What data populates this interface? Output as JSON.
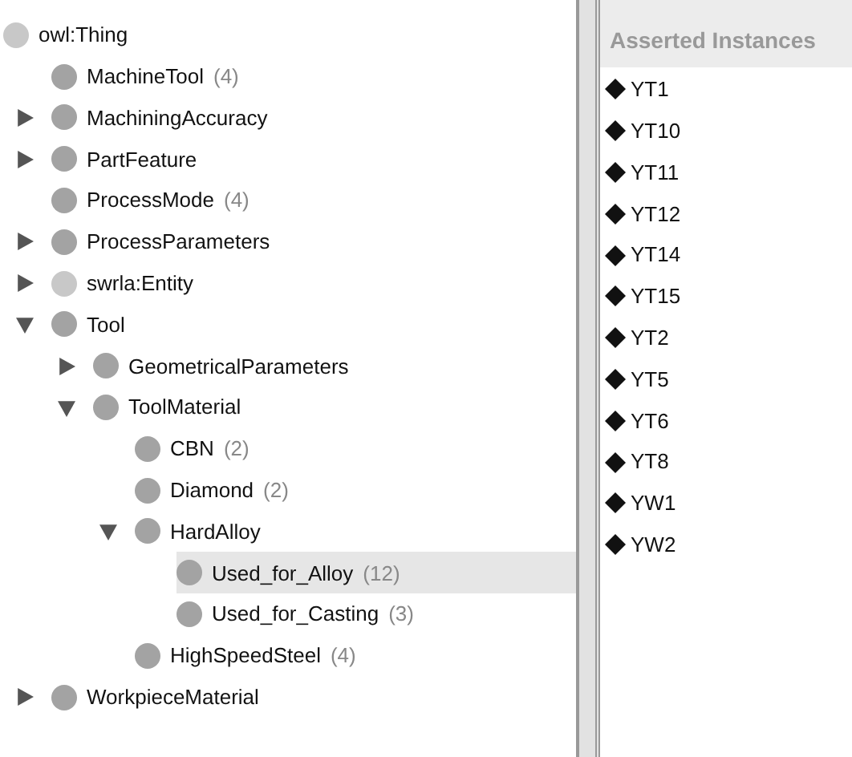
{
  "class_tree": {
    "label": "owl:Thing",
    "color": "#c8c8c8",
    "selected": false,
    "children": [
      {
        "label": "MachineTool",
        "count": "(4)",
        "color": "#a3a3a3",
        "selected": false
      },
      {
        "label": "MachiningAccuracy",
        "color": "#a3a3a3",
        "expanded": false,
        "selected": false
      },
      {
        "label": "PartFeature",
        "color": "#a3a3a3",
        "expanded": false,
        "selected": false
      },
      {
        "label": "ProcessMode",
        "count": "(4)",
        "color": "#a3a3a3",
        "selected": false
      },
      {
        "label": "ProcessParameters",
        "color": "#a3a3a3",
        "expanded": false,
        "selected": false
      },
      {
        "label": "swrla:Entity",
        "color": "#c8c8c8",
        "expanded": false,
        "selected": false
      },
      {
        "label": "Tool",
        "color": "#a3a3a3",
        "expanded": true,
        "selected": false,
        "children": [
          {
            "label": "GeometricalParameters",
            "color": "#a3a3a3",
            "expanded": false,
            "selected": false
          },
          {
            "label": "ToolMaterial",
            "color": "#a3a3a3",
            "expanded": true,
            "selected": false,
            "children": [
              {
                "label": "CBN",
                "count": "(2)",
                "color": "#a3a3a3",
                "selected": false
              },
              {
                "label": "Diamond",
                "count": "(2)",
                "color": "#a3a3a3",
                "selected": false
              },
              {
                "label": "HardAlloy",
                "color": "#a3a3a3",
                "expanded": true,
                "selected": false,
                "children": [
                  {
                    "label": "Used_for_Alloy",
                    "count": "(12)",
                    "color": "#a3a3a3",
                    "selected": true
                  },
                  {
                    "label": "Used_for_Casting",
                    "count": "(3)",
                    "color": "#a3a3a3",
                    "selected": false
                  }
                ]
              },
              {
                "label": "HighSpeedSteel",
                "count": "(4)",
                "color": "#a3a3a3",
                "selected": false
              }
            ]
          }
        ]
      },
      {
        "label": "WorkpieceMaterial",
        "color": "#a3a3a3",
        "expanded": false,
        "selected": false
      }
    ]
  },
  "instances_panel": {
    "title": "Asserted Instances",
    "items": [
      "YT1",
      "YT10",
      "YT11",
      "YT12",
      "YT14",
      "YT15",
      "YT2",
      "YT5",
      "YT6",
      "YT8",
      "YW1",
      "YW2"
    ]
  }
}
